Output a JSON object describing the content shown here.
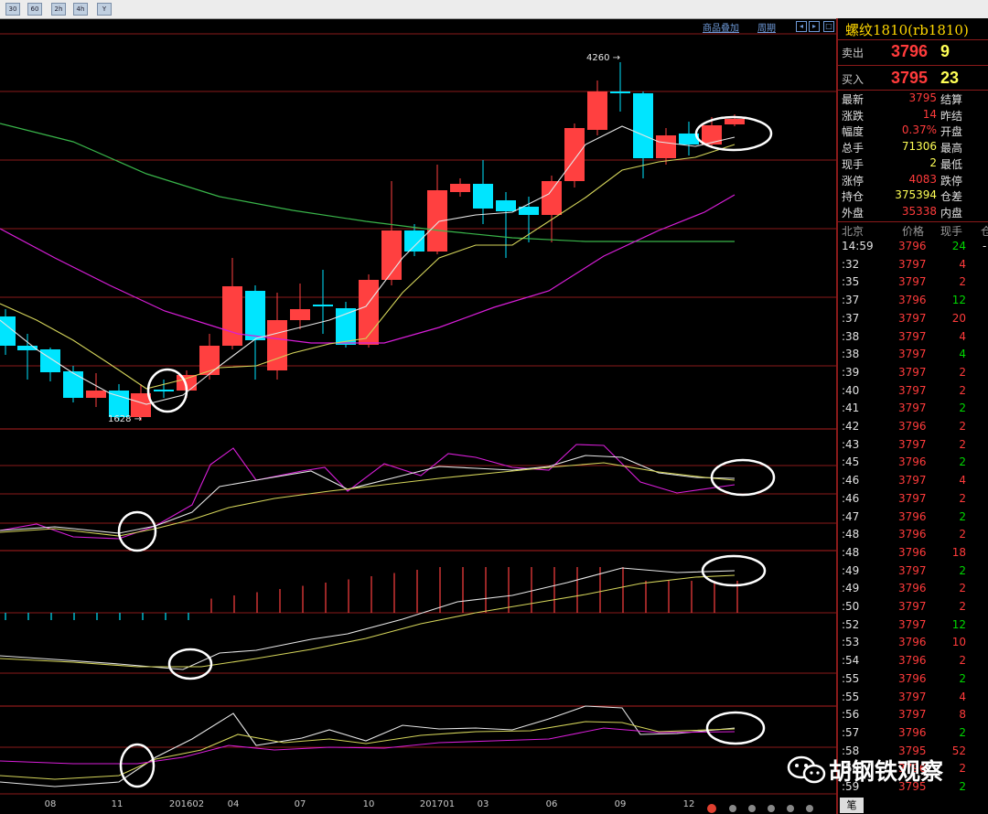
{
  "toolbar": {
    "buttons": [
      "30",
      "60",
      "2h",
      "4h",
      "Y"
    ]
  },
  "chart_toolbar": {
    "overlay_link": "商品叠加",
    "period_link": "周期"
  },
  "chart": {
    "high_label": "4260",
    "low_label": "1628",
    "x_ticks": [
      "08",
      "11",
      "201602",
      "04",
      "07",
      "10",
      "201701",
      "03",
      "06",
      "09",
      "12"
    ]
  },
  "quote": {
    "title": "螺纹1810(rb1810)",
    "sell_label": "卖出",
    "sell_price": "3796",
    "sell_qty": "9",
    "buy_label": "买入",
    "buy_price": "3795",
    "buy_qty": "23",
    "stats": [
      {
        "label": "最新",
        "value": "3795",
        "right": "结算"
      },
      {
        "label": "涨跌",
        "value": "14",
        "right": "昨结"
      },
      {
        "label": "幅度",
        "value": "0.37%",
        "right": "开盘"
      },
      {
        "label": "总手",
        "value": "71306",
        "right": "最高"
      },
      {
        "label": "现手",
        "value": "2",
        "right": "最低"
      },
      {
        "label": "涨停",
        "value": "4083",
        "right": "跌停"
      },
      {
        "label": "持仓",
        "value": "375394",
        "right": "仓差"
      },
      {
        "label": "外盘",
        "value": "35338",
        "right": "内盘"
      }
    ],
    "ticks_header": {
      "time": "北京",
      "price": "价格",
      "qty": "现手",
      "pos": "仓"
    },
    "ticks": [
      {
        "time": "14:59",
        "price": "3796",
        "qty": "24",
        "pos": "-"
      },
      {
        "time": ":32",
        "price": "3797",
        "qty": "4",
        "pos": ""
      },
      {
        "time": ":35",
        "price": "3797",
        "qty": "2",
        "pos": ""
      },
      {
        "time": ":37",
        "price": "3796",
        "qty": "12",
        "pos": ""
      },
      {
        "time": ":37",
        "price": "3797",
        "qty": "20",
        "pos": ""
      },
      {
        "time": ":38",
        "price": "3797",
        "qty": "4",
        "pos": ""
      },
      {
        "time": ":38",
        "price": "3797",
        "qty": "4",
        "pos": ""
      },
      {
        "time": ":39",
        "price": "3797",
        "qty": "2",
        "pos": ""
      },
      {
        "time": ":40",
        "price": "3797",
        "qty": "2",
        "pos": ""
      },
      {
        "time": ":41",
        "price": "3797",
        "qty": "2",
        "pos": ""
      },
      {
        "time": ":42",
        "price": "3796",
        "qty": "2",
        "pos": ""
      },
      {
        "time": ":43",
        "price": "3797",
        "qty": "2",
        "pos": ""
      },
      {
        "time": ":45",
        "price": "3796",
        "qty": "2",
        "pos": ""
      },
      {
        "time": ":46",
        "price": "3797",
        "qty": "4",
        "pos": ""
      },
      {
        "time": ":46",
        "price": "3797",
        "qty": "2",
        "pos": ""
      },
      {
        "time": ":47",
        "price": "3796",
        "qty": "2",
        "pos": ""
      },
      {
        "time": ":48",
        "price": "3796",
        "qty": "2",
        "pos": ""
      },
      {
        "time": ":48",
        "price": "3796",
        "qty": "18",
        "pos": ""
      },
      {
        "time": ":49",
        "price": "3797",
        "qty": "2",
        "pos": ""
      },
      {
        "time": ":49",
        "price": "3796",
        "qty": "2",
        "pos": ""
      },
      {
        "time": ":50",
        "price": "3797",
        "qty": "2",
        "pos": ""
      },
      {
        "time": ":52",
        "price": "3797",
        "qty": "12",
        "pos": ""
      },
      {
        "time": ":53",
        "price": "3796",
        "qty": "10",
        "pos": ""
      },
      {
        "time": ":54",
        "price": "3796",
        "qty": "2",
        "pos": ""
      },
      {
        "time": ":55",
        "price": "3796",
        "qty": "2",
        "pos": ""
      },
      {
        "time": ":55",
        "price": "3797",
        "qty": "4",
        "pos": ""
      },
      {
        "time": ":56",
        "price": "3797",
        "qty": "8",
        "pos": ""
      },
      {
        "time": ":57",
        "price": "3796",
        "qty": "2",
        "pos": ""
      },
      {
        "time": ":58",
        "price": "3795",
        "qty": "52",
        "pos": ""
      },
      {
        "time": ":58",
        "price": "3796",
        "qty": "2",
        "pos": ""
      },
      {
        "time": ":59",
        "price": "3795",
        "qty": "2",
        "pos": ""
      }
    ],
    "bottom_tab": "笔"
  },
  "watermark": {
    "text": "胡钢铁观察"
  },
  "colors": {
    "up": "#ff4040",
    "down": "#00e5ff",
    "grid": "#8a1a1a",
    "ma_short": "#e6e6e6",
    "ma_mid": "#d4d45a",
    "ma_long_green": "#39b54a",
    "ma_long_magenta": "#d81ed8"
  }
}
